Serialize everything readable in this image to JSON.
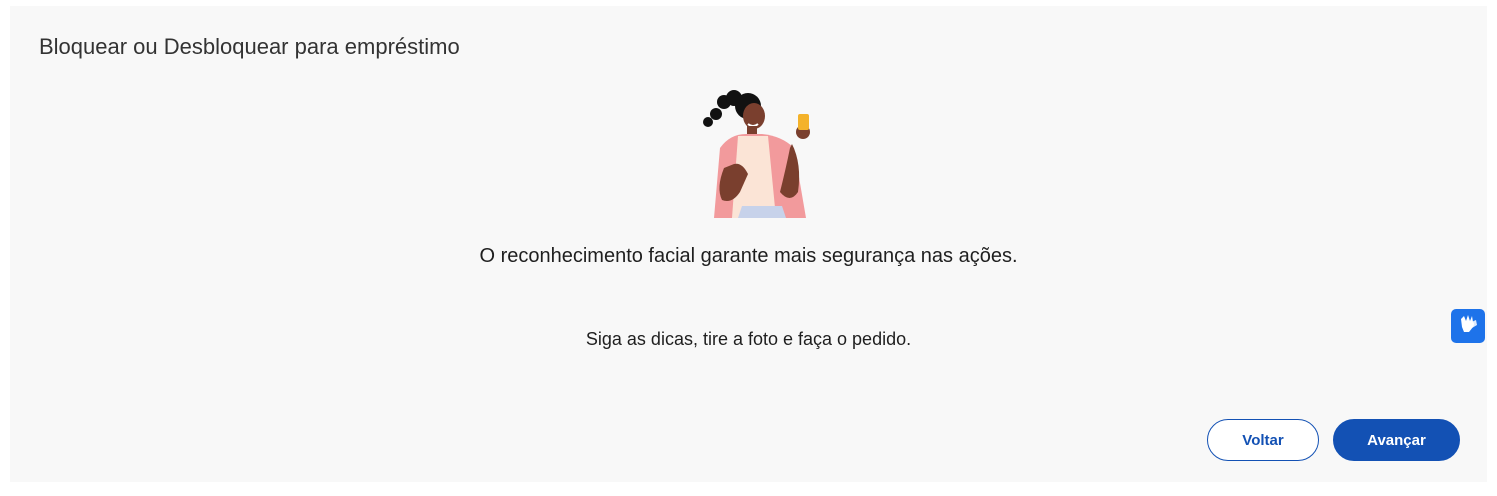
{
  "page": {
    "title": "Bloquear ou Desbloquear para empréstimo"
  },
  "content": {
    "headline": "O reconhecimento facial garante mais segurança nas ações.",
    "subline": "Siga as dicas, tire a foto e faça o pedido.",
    "illustration": "person-holding-phone-illustration"
  },
  "actions": {
    "back_label": "Voltar",
    "next_label": "Avançar"
  },
  "accessibility": {
    "icon": "sign-language-icon"
  },
  "colors": {
    "primary": "#1351b4",
    "card_background": "#f8f8f8",
    "widget": "#1e73ea"
  }
}
